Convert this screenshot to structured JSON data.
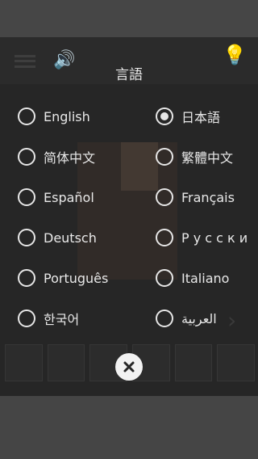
{
  "dialog": {
    "title": "言語",
    "selected": "日本語"
  },
  "languages": [
    {
      "label": "English",
      "checked": false
    },
    {
      "label": "日本語",
      "checked": true
    },
    {
      "label": "简体中文",
      "checked": false
    },
    {
      "label": "繁體中文",
      "checked": false
    },
    {
      "label": "Español",
      "checked": false
    },
    {
      "label": "Français",
      "checked": false
    },
    {
      "label": "Deutsch",
      "checked": false
    },
    {
      "label": "Р у с с к и",
      "checked": false
    },
    {
      "label": "Português",
      "checked": false
    },
    {
      "label": "Italiano",
      "checked": false
    },
    {
      "label": "한국어",
      "checked": false
    },
    {
      "label": "العربية",
      "checked": false
    }
  ],
  "icons": {
    "close": "close-icon",
    "radio": "radio-icon"
  },
  "colors": {
    "overlay": "#262626",
    "text": "#e8e8e8",
    "close_bg": "#f2f2f2"
  }
}
